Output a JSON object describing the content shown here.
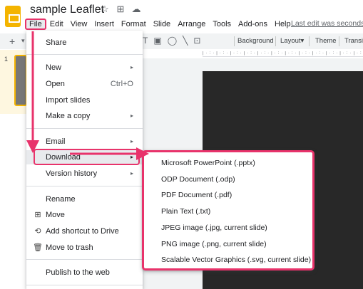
{
  "header": {
    "doc_title": "sample Leaflet",
    "last_edit": "Last edit was seconds"
  },
  "menubar": {
    "items": [
      "File",
      "Edit",
      "View",
      "Insert",
      "Format",
      "Slide",
      "Arrange",
      "Tools",
      "Add-ons",
      "Help"
    ]
  },
  "toolbar": {
    "background_label": "Background",
    "layout_label": "Layout",
    "theme_label": "Theme",
    "transition_label": "Transi"
  },
  "filmstrip": {
    "slide_number": "1"
  },
  "file_menu": {
    "share": "Share",
    "new": "New",
    "open": "Open",
    "open_shortcut": "Ctrl+O",
    "import_slides": "Import slides",
    "make_copy": "Make a copy",
    "email": "Email",
    "download": "Download",
    "version_history": "Version history",
    "rename": "Rename",
    "move": "Move",
    "add_shortcut": "Add shortcut to Drive",
    "move_to_trash": "Move to trash",
    "publish": "Publish to the web"
  },
  "download_menu": {
    "options": [
      "Microsoft PowerPoint (.pptx)",
      "ODP Document (.odp)",
      "PDF Document (.pdf)",
      "Plain Text (.txt)",
      "JPEG image (.jpg, current slide)",
      "PNG image (.png, current slide)",
      "Scalable Vector Graphics (.svg, current slide)"
    ]
  },
  "colors": {
    "highlight": "#e8336b",
    "slides_brand": "#f4b400",
    "canvas": "#282828"
  },
  "icons": {
    "star": "star-icon",
    "folder": "move-to-folder-icon",
    "cloud": "cloud-saved-icon",
    "move": "folder-move-icon",
    "shortcut": "drive-shortcut-icon",
    "trash": "trash-icon"
  }
}
